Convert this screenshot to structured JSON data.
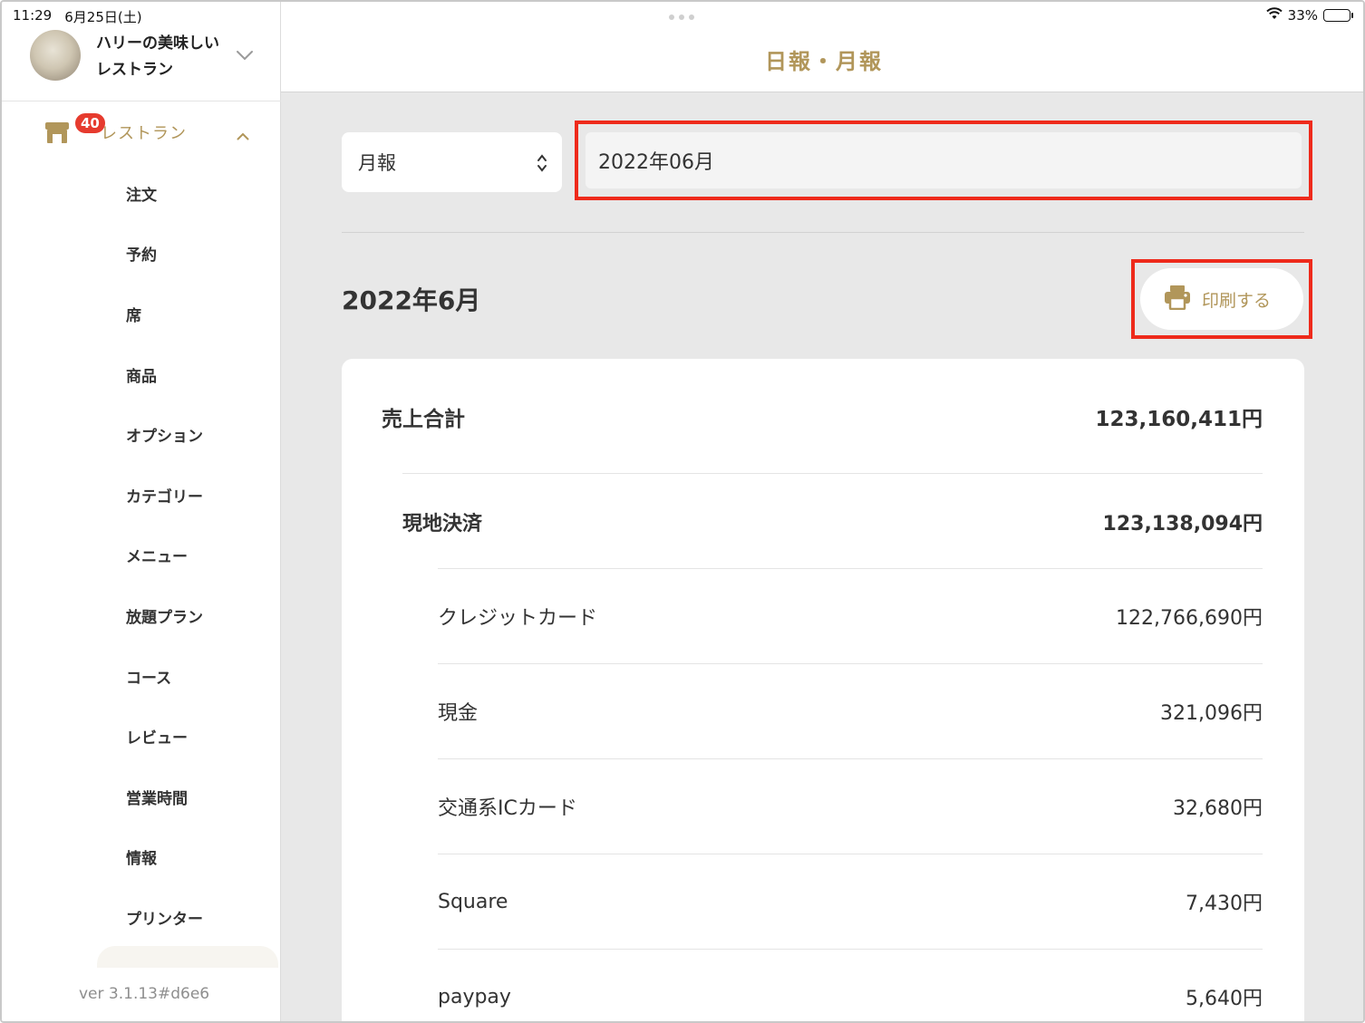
{
  "status_bar": {
    "time": "11:29",
    "date": "6月25日(土)",
    "battery": "33%",
    "battery_level": 0.33
  },
  "sidebar": {
    "store_name": "ハリーの美味しいレストラン",
    "section": {
      "label": "レストラン",
      "badge": "40"
    },
    "items": [
      {
        "label": "注文"
      },
      {
        "label": "予約"
      },
      {
        "label": "席"
      },
      {
        "label": "商品"
      },
      {
        "label": "オプション"
      },
      {
        "label": "カテゴリー"
      },
      {
        "label": "メニュー"
      },
      {
        "label": "放題プラン"
      },
      {
        "label": "コース"
      },
      {
        "label": "レビュー"
      },
      {
        "label": "営業時間"
      },
      {
        "label": "情報"
      },
      {
        "label": "プリンター"
      }
    ],
    "version": "ver 3.1.13#d6e6"
  },
  "header": {
    "title": "日報・月報"
  },
  "filters": {
    "report_type": "月報",
    "month_value": "2022年06月"
  },
  "report": {
    "heading": "2022年6月",
    "print_label": "印刷する",
    "total": {
      "label": "売上合計",
      "value": "123,160,411円"
    },
    "onsite": {
      "label": "現地決済",
      "value": "123,138,094円"
    },
    "methods": [
      {
        "label": "クレジットカード",
        "value": "122,766,690円"
      },
      {
        "label": "現金",
        "value": "321,096円"
      },
      {
        "label": "交通系ICカード",
        "value": "32,680円"
      },
      {
        "label": "Square",
        "value": "7,430円"
      },
      {
        "label": "paypay",
        "value": "5,640円"
      }
    ]
  },
  "colors": {
    "accent": "#b1965a",
    "highlight": "#ee2a1b",
    "badge": "#e63b2e",
    "background": "#e8e8e8"
  }
}
